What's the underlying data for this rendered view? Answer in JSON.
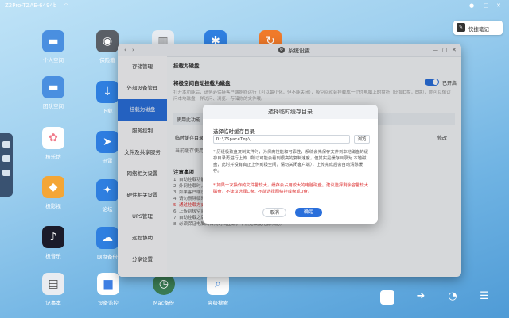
{
  "topbar": {
    "title": "Z2Pro-TZAE-6494b"
  },
  "quick": {
    "label": "快捷笔记"
  },
  "desktop": {
    "left": [
      {
        "label": "个人空间",
        "icon": "folder-icon",
        "color": "#4a8fe0"
      },
      {
        "label": "团队空间",
        "icon": "team-folder-icon",
        "color": "#4a8fe0"
      },
      {
        "label": "极乐坊",
        "icon": "flower-icon",
        "color": "#f07a8a"
      },
      {
        "label": "极影视",
        "icon": "film-icon",
        "color": "#f4a636"
      },
      {
        "label": "极音乐",
        "icon": "music-note-icon",
        "color": "#1b1b2a"
      },
      {
        "label": "记事本",
        "icon": "notepad-icon",
        "color": "#e9ecf1"
      }
    ],
    "col2": [
      {
        "label": "保险箱",
        "icon": "safe-icon",
        "color": "#5a5f66"
      },
      {
        "label": "下载",
        "icon": "download-icon",
        "color": "#2f7fe0"
      },
      {
        "label": "迅雷",
        "icon": "thunder-icon",
        "color": "#2e7de0"
      },
      {
        "label": "论坛",
        "icon": "forum-icon",
        "color": "#2f7fe0"
      },
      {
        "label": "网盘备份",
        "icon": "cloud-backup-icon",
        "color": "#2f7fe0"
      }
    ],
    "bottom": [
      {
        "label": "设备监控",
        "icon": "bar-chart-icon",
        "color": "#3e7fe3"
      },
      {
        "label": "Mac备份",
        "icon": "time-machine-icon",
        "color": "#3a7a52"
      },
      {
        "label": "高级搜索",
        "icon": "search-icon",
        "color": "#2f7fe0"
      }
    ]
  },
  "window": {
    "title": "系统设置",
    "sidebar": [
      "存储管理",
      "外部设备管理",
      "挂载为磁盘",
      "服务控制",
      "文件及共享服务",
      "网络相关设置",
      "硬件相关设置",
      "UPS管理",
      "远程协助",
      "分享设置"
    ],
    "active_index": 2,
    "page_title": "挂载为磁盘",
    "section1": "将极空间自动挂载为磁盘",
    "toggle_label": "已开启",
    "desc": "打开本功能后，请务必保持客户端始终运行（可以最小化，但不能关闭），极空间就会挂载成一个你电脑上的盘符（比如D盘，E盘），你可以像访问本地磁盘一样访问、浏览、存储你的文件哦。",
    "section2": "使用此功能",
    "row1_label": "临时缓存目录",
    "row1_action": "修改",
    "row2_label": "当前缓存使用:",
    "notes_title": "注意事项",
    "notes": [
      "1. 自动挂载功能必须保持极空间客户端处于运行状态。",
      "2. 外网挂载时，传输速度受网络带宽限制，建议在局域网环境下使用挂载功能。",
      "3. 如果客户端设置了自动启动，挂载功能也会同步启动。",
      "4. 请勿删除临时缓存目录中的文件，以免造成数据丢失，以及挂载功能的使用。",
      "5. 通过挂载方式修改的文件会先写入临时缓存目录，再上传至极空间，上传过程中请勿关闭客户端。",
      "6. 上传到极空间的文件需要一定的时间处理，请耐心等待。",
      "7. 自动挂载之后，通过电脑删除极空间中的内容会彻底删除，不能进入回收站，请谨慎删除。",
      "8. 必须保证电脑的日期时间正确，不然无法使用此功能。"
    ]
  },
  "dialog": {
    "title": "选择临时缓存目录",
    "label": "选择临时缓存目录",
    "path": "D:\\ZSpaceTmp\\",
    "browse": "浏览",
    "note1": "* 历经极致盘复制文件时，为保高性能和可靠性，系统会先保存文件到本地磁盘的缓存目录再进行上传（所以可能会看到很高的复制速度，但其实是缓存目录为 本地磁盘，此时并没有真正上传到极空间，请勿关闭客户端），上传完成后会自动清除缓存。",
    "note2": "* 如果一次操作的文件量较大，缓存会占用较大的电脑磁盘。建议选择剩余容量较大磁盘，不建议选择C盘。不能选择网络挂载盘或U盘。",
    "cancel": "取消",
    "ok": "确定"
  }
}
